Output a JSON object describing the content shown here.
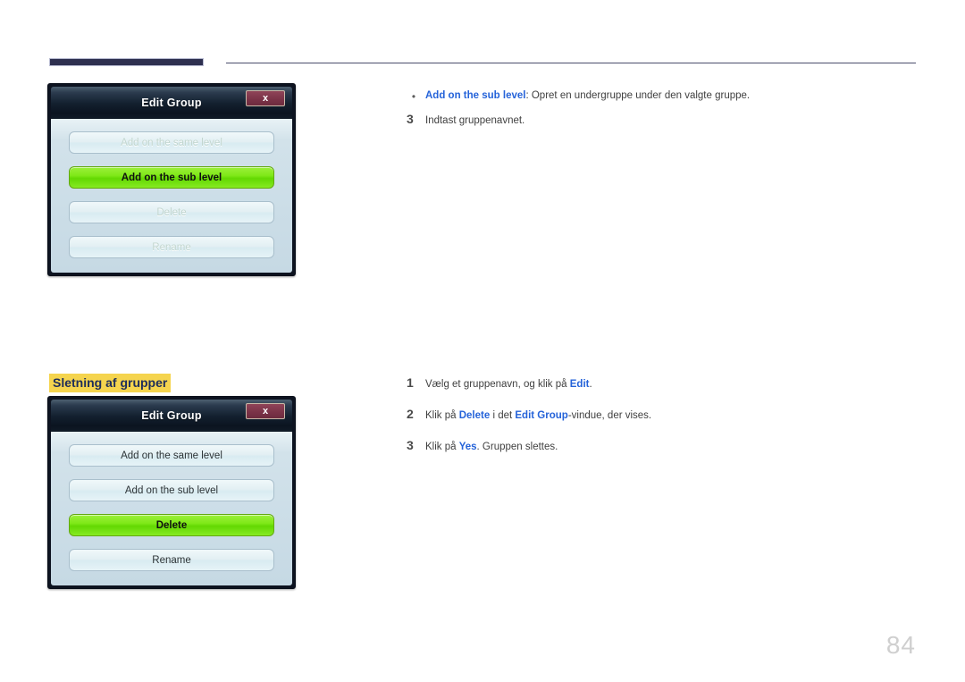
{
  "page": {
    "number": "84"
  },
  "section": {
    "heading": "Sletning af grupper"
  },
  "dialogs": [
    {
      "title": "Edit Group",
      "close_label": "x",
      "buttons": [
        {
          "label": "Add on the same level",
          "state": "disabled"
        },
        {
          "label": "Add on the sub level",
          "state": "highlight"
        },
        {
          "label": "Delete",
          "state": "disabled"
        },
        {
          "label": "Rename",
          "state": "disabled"
        }
      ]
    },
    {
      "title": "Edit Group",
      "close_label": "x",
      "buttons": [
        {
          "label": "Add on the same level",
          "state": "enabled"
        },
        {
          "label": "Add on the sub level",
          "state": "enabled"
        },
        {
          "label": "Delete",
          "state": "highlight"
        },
        {
          "label": "Rename",
          "state": "enabled"
        }
      ]
    }
  ],
  "content": {
    "bullet": {
      "marker": "•",
      "keyword": "Add on the sub level",
      "text_after": ": Opret en undergruppe under den valgte gruppe."
    },
    "steps_top": [
      {
        "marker": "3",
        "text": "Indtast gruppenavnet."
      }
    ],
    "steps_bottom": [
      {
        "marker": "1",
        "pre": "Vælg et gruppenavn, og klik på ",
        "kw1": "Edit",
        "mid": ".",
        "kw2": "",
        "post": ""
      },
      {
        "marker": "2",
        "pre": "Klik på ",
        "kw1": "Delete",
        "mid": " i det ",
        "kw2": "Edit Group",
        "post": "-vindue, der vises."
      },
      {
        "marker": "3",
        "pre": "Klik på ",
        "kw1": "Yes",
        "mid": ". Gruppen slettes.",
        "kw2": "",
        "post": ""
      }
    ]
  },
  "colors": {
    "accent_blue": "#2563d9",
    "highlight_yellow": "#f5d44e",
    "rule_navy": "#2e3050",
    "button_green": "#7ee817",
    "close_maroon": "#7b3348"
  }
}
